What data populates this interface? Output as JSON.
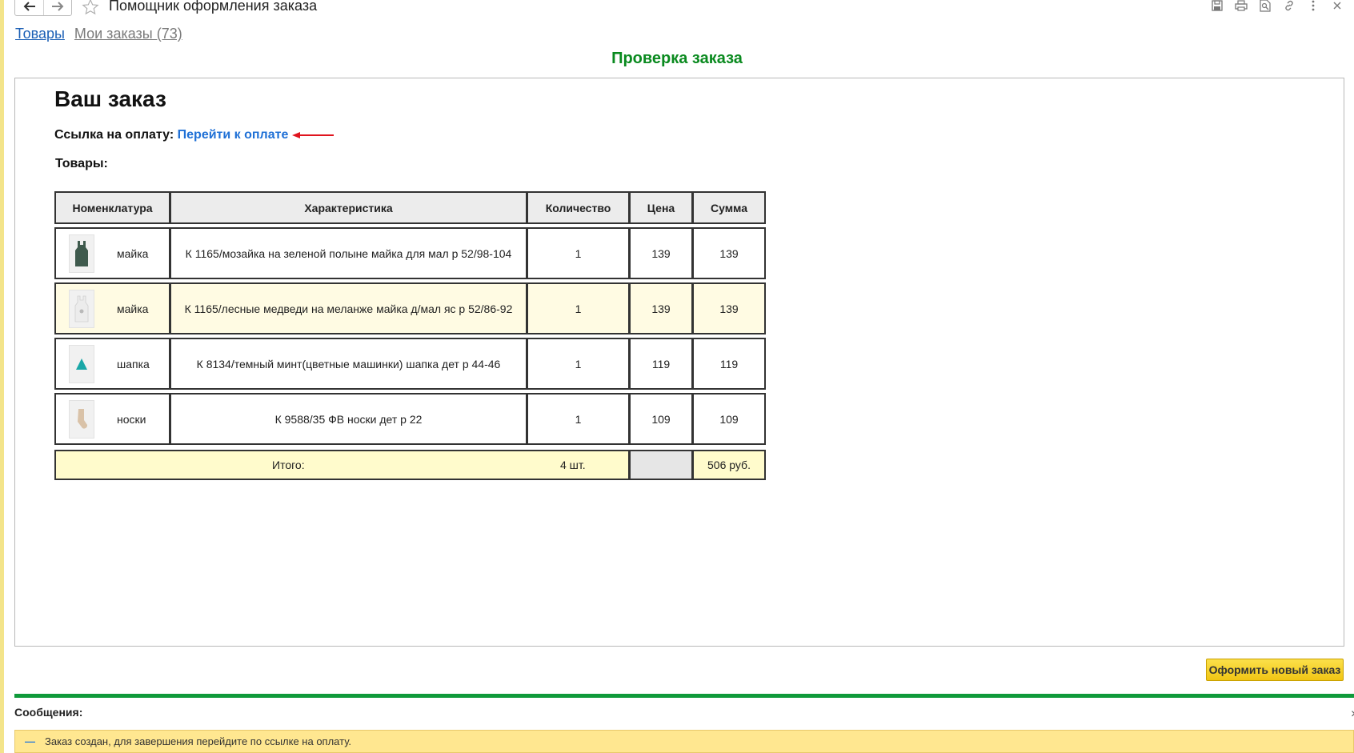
{
  "window": {
    "title": "Помощник оформления заказа",
    "back_icon": "arrow-left-icon",
    "forward_icon": "arrow-right-icon",
    "favorite_icon": "star-icon",
    "tools": [
      "save-icon",
      "print-icon",
      "preview-icon",
      "link-icon",
      "more-icon",
      "close-icon"
    ]
  },
  "tabs": [
    {
      "label": "Товары"
    },
    {
      "label": "Мои заказы (73)"
    }
  ],
  "page": {
    "heading": "Проверка заказа",
    "order_title": "Ваш заказ",
    "pay_label": "Ссылка на оплату:",
    "pay_link": "Перейти к оплате",
    "goods_label": "Товары:"
  },
  "table": {
    "headers": [
      "Номенклатура",
      "Характеристика",
      "Количество",
      "Цена",
      "Сумма"
    ],
    "rows": [
      {
        "nom": "майка",
        "char": "К 1165/мозайка на зеленой полыне майка для мал р 52/98-104",
        "qty": "1",
        "price": "139",
        "sum": "139",
        "thumb_color": "#3f5a4d"
      },
      {
        "nom": "майка",
        "char": "К 1165/лесные медведи на меланже майка д/мал яс р 52/86-92",
        "qty": "1",
        "price": "139",
        "sum": "139",
        "thumb_color": "#e4e4e4"
      },
      {
        "nom": "шапка",
        "char": "К 8134/темный минт(цветные машинки) шапка дет р 44-46",
        "qty": "1",
        "price": "119",
        "sum": "119",
        "thumb_color": "#19a7a7"
      },
      {
        "nom": "носки",
        "char": "К 9588/35 ФВ носки дет р 22",
        "qty": "1",
        "price": "109",
        "sum": "109",
        "thumb_color": "#d9c2a8"
      }
    ],
    "total": {
      "label": "Итого:",
      "qty": "4 шт.",
      "sum": "506 руб."
    }
  },
  "actions": {
    "new_order": "Оформить новый заказ"
  },
  "messages": {
    "title": "Сообщения:",
    "close": "×",
    "text": "Заказ создан, для завершения перейдите по ссылке на оплату."
  },
  "colors": {
    "heading": "#0a8a1f",
    "link": "#1f70d6",
    "button": "#f1c514",
    "separator": "#0f9a3a",
    "message_bg": "#ffe790",
    "annotation_arrow": "#e0141e"
  }
}
